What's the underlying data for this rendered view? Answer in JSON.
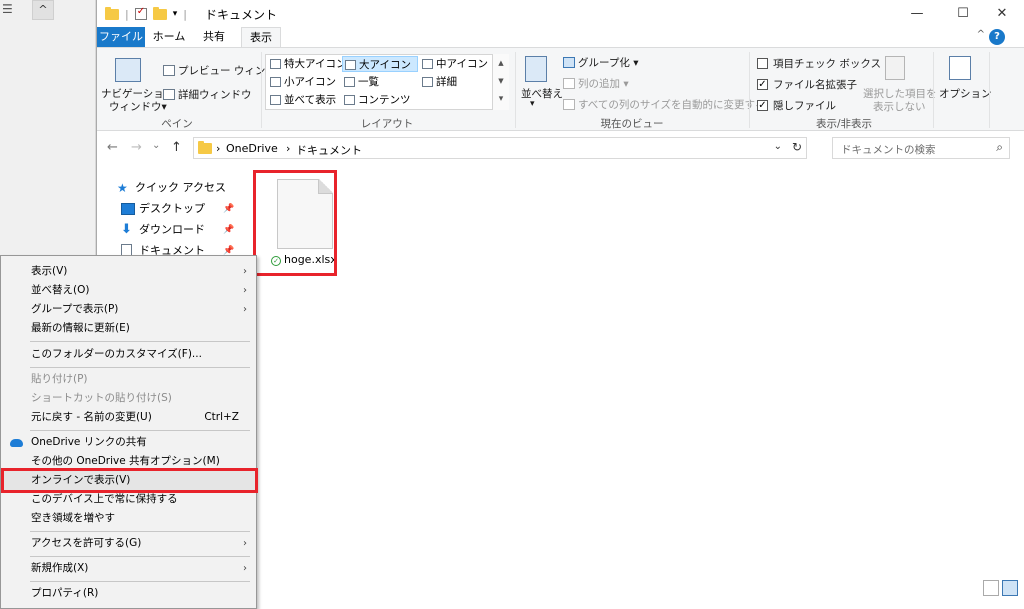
{
  "quick_access_toolbar": {
    "separator": "|",
    "dropdown_glyph": "▾"
  },
  "window": {
    "title": "ドキュメント",
    "minimize_glyph": "—",
    "maximize_glyph": "☐",
    "close_glyph": "✕"
  },
  "ribbon_tabs": [
    "ファイル",
    "ホーム",
    "共有",
    "表示"
  ],
  "ribbon_help": "?",
  "ribbon_collapse": "^",
  "ribbon": {
    "pane": {
      "navigation_pane": "ナビゲーション",
      "navigation_pane2": "ウィンドウ▾",
      "preview_pane": "プレビュー ウィンドウ",
      "details_pane": "詳細ウィンドウ",
      "label": "ペイン"
    },
    "layout": {
      "items": [
        "特大アイコン",
        "大アイコン",
        "中アイコン",
        "小アイコン",
        "一覧",
        "詳細",
        "並べて表示",
        "コンテンツ"
      ],
      "scroll_up": "▲",
      "scroll_down": "▼",
      "scroll_more": "▾",
      "label": "レイアウト"
    },
    "current_view": {
      "sort_by": "並べ替え",
      "sort_by_glyph": "▾",
      "group_by": "グループ化 ▾",
      "add_columns": "列の追加 ▾",
      "size_all_columns": "すべての列のサイズを自動的に変更する",
      "label": "現在のビュー"
    },
    "show_hide": {
      "item_checkboxes": "項目チェック ボックス",
      "file_extensions": "ファイル名拡張子",
      "hidden_items": "隠しファイル",
      "hide_selected_1": "選択した項目を",
      "hide_selected_2": "表示しない",
      "checked_glyph": "✓",
      "label": "表示/非表示"
    },
    "options": "オプション"
  },
  "address": {
    "back": "←",
    "forward": "→",
    "recent": "⌄",
    "up": "↑",
    "crumbs": [
      "›",
      "OneDrive",
      "›",
      "ドキュメント"
    ],
    "dropdown": "⌄",
    "refresh": "↻",
    "search_placeholder": "ドキュメントの検索",
    "search_glyph": "⌕"
  },
  "nav_pane": {
    "quick_access": "クイック アクセス",
    "items": [
      "デスクトップ",
      "ダウンロード",
      "ドキュメント"
    ],
    "pin_glyph": "📌"
  },
  "files": [
    {
      "name": "hoge.xlsx",
      "sync_glyph": "✓"
    }
  ],
  "context_menu": {
    "items": [
      {
        "label": "表示(V)",
        "arrow": "›"
      },
      {
        "label": "並べ替え(O)",
        "arrow": "›"
      },
      {
        "label": "グループで表示(P)",
        "arrow": "›"
      },
      {
        "label": "最新の情報に更新(E)"
      },
      {
        "label": "このフォルダーのカスタマイズ(F)..."
      },
      {
        "label": "貼り付け(P)"
      },
      {
        "label": "ショートカットの貼り付け(S)"
      },
      {
        "label": "元に戻す - 名前の変更(U)",
        "shortcut": "Ctrl+Z"
      },
      {
        "label": "OneDrive リンクの共有"
      },
      {
        "label": "その他の OneDrive 共有オプション(M)"
      },
      {
        "label": "オンラインで表示(V)"
      },
      {
        "label": "このデバイス上で常に保持する"
      },
      {
        "label": "空き領域を増やす"
      },
      {
        "label": "アクセスを許可する(G)",
        "arrow": "›"
      },
      {
        "label": "新規作成(X)",
        "arrow": "›"
      },
      {
        "label": "プロパティ(R)"
      }
    ]
  },
  "background_window": {
    "menu_glyph": "☰",
    "up_glyph": "^"
  },
  "colors": {
    "accent": "#1979ca",
    "highlight_box": "#e8232b",
    "selection": "#cce8ff"
  }
}
